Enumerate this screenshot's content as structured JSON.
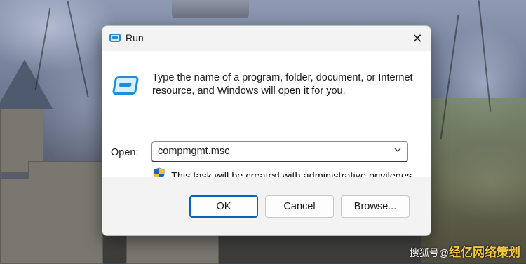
{
  "dialog": {
    "title": "Run",
    "close_symbol": "✕",
    "description": "Type the name of a program, folder, document, or Internet resource, and Windows will open it for you.",
    "open_label": "Open:",
    "open_value": "compmgmt.msc",
    "admin_note": "This task will be created with administrative privileges.",
    "buttons": {
      "ok": "OK",
      "cancel": "Cancel",
      "browse": "Browse..."
    },
    "icons": {
      "title": "run-icon",
      "large": "run-icon",
      "shield": "uac-shield-icon",
      "dropdown": "chevron-down-icon",
      "close": "close-icon"
    },
    "accent_color": "#0067c0"
  },
  "wallpaper": {
    "watermark_prefix": "搜狐号@",
    "watermark_text": "经亿网络策划"
  }
}
